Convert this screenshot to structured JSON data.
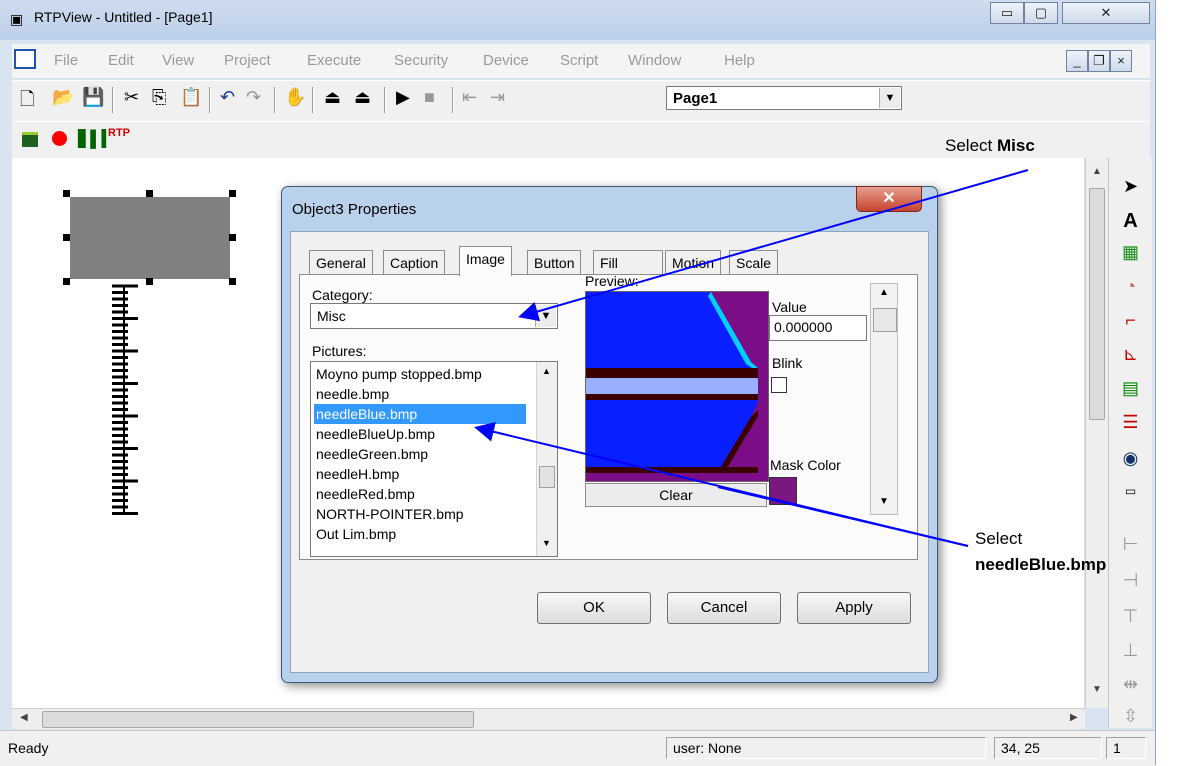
{
  "window": {
    "title": "RTPView  -  Untitled - [Page1]"
  },
  "menu": [
    "File",
    "Edit",
    "View",
    "Project",
    "Execute",
    "Security",
    "Device",
    "Script",
    "Window",
    "Help"
  ],
  "toolbar": {
    "page_select": "Page1"
  },
  "status": {
    "left": "Ready",
    "user": "user: None",
    "coords": "34, 25",
    "page": "1"
  },
  "dialog": {
    "title": "Object3 Properties",
    "tabs": [
      "General",
      "Caption",
      "Image",
      "Button",
      "Fill",
      "Motion",
      "Scale"
    ],
    "active_tab": "Image",
    "category_label": "Category:",
    "category_value": "Misc",
    "pictures_label": "Pictures:",
    "pictures": [
      "Moyno pump stopped.bmp",
      "needle.bmp",
      "needleBlue.bmp",
      "needleBlueUp.bmp",
      "needleGreen.bmp",
      "needleH.bmp",
      "needleRed.bmp",
      "NORTH-POINTER.bmp",
      "Out Lim.bmp"
    ],
    "selected_picture": "needleBlue.bmp",
    "preview_label": "Preview:",
    "clear_label": "Clear",
    "value_label": "Value",
    "value": "0.000000",
    "blink_label": "Blink",
    "mask_color_label": "Mask Color",
    "ok_label": "OK",
    "cancel_label": "Cancel",
    "apply_label": "Apply"
  },
  "annotations": {
    "select_misc_prefix": "Select ",
    "select_misc_bold": "Misc",
    "select_needle_prefix": "Select",
    "select_needle_bold": "needleBlue.bmp"
  },
  "colors": {
    "selection": "#3399ff",
    "preview_bg": "#7b0d86",
    "preview_blue": "#0a1fff",
    "annotation_arrow": "#0000ff"
  }
}
